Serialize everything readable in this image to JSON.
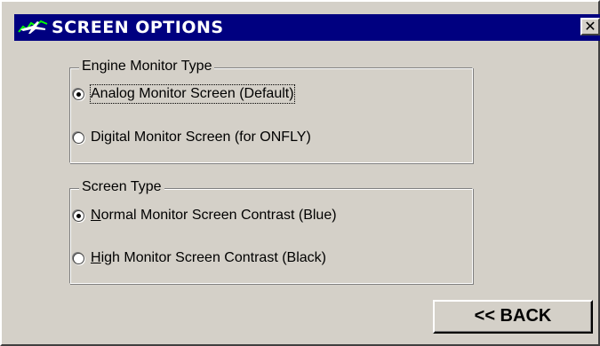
{
  "window": {
    "title": "SCREEN OPTIONS",
    "close_label": "✕",
    "title_bar_color": "#000080",
    "face_color": "#d4d0c8",
    "app_icon": "airplane-icon"
  },
  "engine_monitor_group": {
    "legend": "Engine Monitor Type",
    "options": [
      {
        "label": "Analog Monitor Screen (Default)",
        "selected": true
      },
      {
        "label": "Digital Monitor Screen (for ONFLY)",
        "selected": false
      }
    ]
  },
  "screen_type_group": {
    "legend": "Screen Type",
    "options": [
      {
        "label_mnemonic": "N",
        "label_rest": "ormal Monitor Screen Contrast (Blue)",
        "selected": true
      },
      {
        "label_mnemonic": "H",
        "label_rest": "igh Monitor Screen Contrast (Black)",
        "selected": false
      }
    ]
  },
  "back_button": {
    "label": "<< BACK"
  }
}
